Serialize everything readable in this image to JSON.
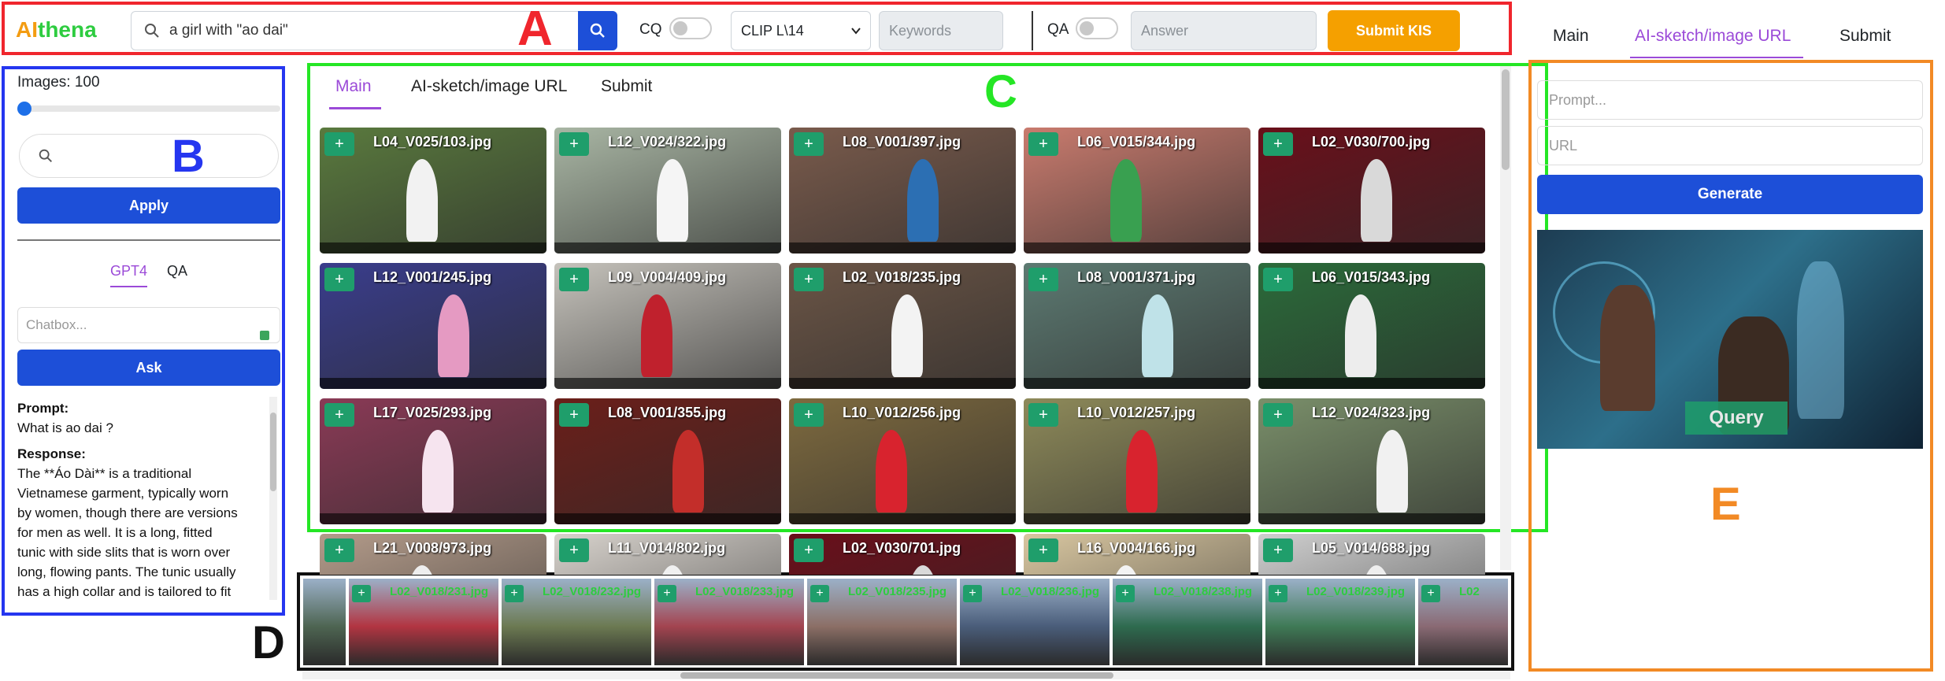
{
  "annotations": {
    "a": "A",
    "b": "B",
    "c": "C",
    "d": "D",
    "e": "E"
  },
  "colors": {
    "red": "#f0262d",
    "blue": "#2536f0",
    "green": "#25e625",
    "black": "#111111",
    "orange": "#f28a25",
    "accent": "#1d4fd8",
    "purple": "#9b4ad8",
    "add": "#1f9e6b"
  },
  "header": {
    "brand_ai": "AI",
    "brand_thena": "thena",
    "search_value": "a girl with \"ao dai\"",
    "cq_label": "CQ",
    "model_select": "CLIP L\\14",
    "keywords_placeholder": "Keywords",
    "qa_label": "QA",
    "answer_placeholder": "Answer",
    "submit_label": "Submit KIS"
  },
  "sidebar": {
    "images_label": "Images: 100",
    "images_value": 100,
    "apply_label": "Apply",
    "tabs": [
      "GPT4",
      "QA"
    ],
    "chat_placeholder": "Chatbox...",
    "ask_label": "Ask",
    "prompt_label": "Prompt:",
    "prompt_text": "What is ao dai ?",
    "response_label": "Response:",
    "response_lines": [
      "The **Áo Dài** is a traditional",
      "Vietnamese garment, typically worn",
      "by women, though there are versions",
      "for men as well. It is a long, fitted",
      "tunic with side slits that is worn over",
      "long, flowing pants. The tunic usually",
      "has a high collar and is tailored to fit"
    ]
  },
  "main_tabs": [
    "Main",
    "AI-sketch/image URL",
    "Submit"
  ],
  "results": [
    {
      "name": "L04_V025/103.jpg",
      "bg": "#5a7a3e",
      "fig": "#f2f2f2"
    },
    {
      "name": "L12_V024/322.jpg",
      "bg": "#a9b6a4",
      "fig": "#f5f5f5"
    },
    {
      "name": "L08_V001/397.jpg",
      "bg": "#7a5b4c",
      "fig": "#2c6fb3"
    },
    {
      "name": "L06_V015/344.jpg",
      "bg": "#c97b6e",
      "fig": "#39a050"
    },
    {
      "name": "L02_V030/700.jpg",
      "bg": "#6a0f1a",
      "fig": "#d9d9d9"
    },
    {
      "name": "L12_V001/245.jpg",
      "bg": "#3a3d8c",
      "fig": "#e59ac2"
    },
    {
      "name": "L09_V004/409.jpg",
      "bg": "#c5c2bb",
      "fig": "#c0212d"
    },
    {
      "name": "L02_V018/235.jpg",
      "bg": "#6b5546",
      "fig": "#f3f3f3"
    },
    {
      "name": "L08_V001/371.jpg",
      "bg": "#5d7a72",
      "fig": "#bfe2e8"
    },
    {
      "name": "L06_V015/343.jpg",
      "bg": "#2b6b3a",
      "fig": "#ededed"
    },
    {
      "name": "L17_V025/293.jpg",
      "bg": "#8a3a56",
      "fig": "#f6e4ef"
    },
    {
      "name": "L08_V001/355.jpg",
      "bg": "#6b1f1a",
      "fig": "#c32e2a"
    },
    {
      "name": "L10_V012/256.jpg",
      "bg": "#7e6a3f",
      "fig": "#d8232e"
    },
    {
      "name": "L10_V012/257.jpg",
      "bg": "#8e8a5a",
      "fig": "#d8232e"
    },
    {
      "name": "L12_V024/323.jpg",
      "bg": "#7a8f6a",
      "fig": "#f1f1f1"
    },
    {
      "name": "L21_V008/973.jpg",
      "bg": "#b39b8a",
      "fig": "#eeeeee"
    },
    {
      "name": "L11_V014/802.jpg",
      "bg": "#d7d2cc",
      "fig": "#f0f0f0"
    },
    {
      "name": "L02_V030/701.jpg",
      "bg": "#6a0f1a",
      "fig": "#d9d9d9"
    },
    {
      "name": "L16_V004/166.jpg",
      "bg": "#d8c6a0",
      "fig": "#f3f3f3"
    },
    {
      "name": "L05_V014/688.jpg",
      "bg": "#cfcfcf",
      "fig": "#eeeeee"
    }
  ],
  "strip": [
    {
      "name": "",
      "bg": "#4e6552"
    },
    {
      "name": "L02_V018/231.jpg",
      "bg": "#b23542"
    },
    {
      "name": "L02_V018/232.jpg",
      "bg": "#6c7a52"
    },
    {
      "name": "L02_V018/233.jpg",
      "bg": "#a34450"
    },
    {
      "name": "L02_V018/235.jpg",
      "bg": "#8c6f66"
    },
    {
      "name": "L02_V018/236.jpg",
      "bg": "#4a5d7a"
    },
    {
      "name": "L02_V018/238.jpg",
      "bg": "#2e6b4f"
    },
    {
      "name": "L02_V018/239.jpg",
      "bg": "#3f7a56"
    },
    {
      "name": "L02",
      "bg": "#8a6a74"
    }
  ],
  "right_panel": {
    "prompt_placeholder": "Prompt...",
    "url_placeholder": "URL",
    "generate_label": "Generate",
    "query_label": "Query"
  }
}
